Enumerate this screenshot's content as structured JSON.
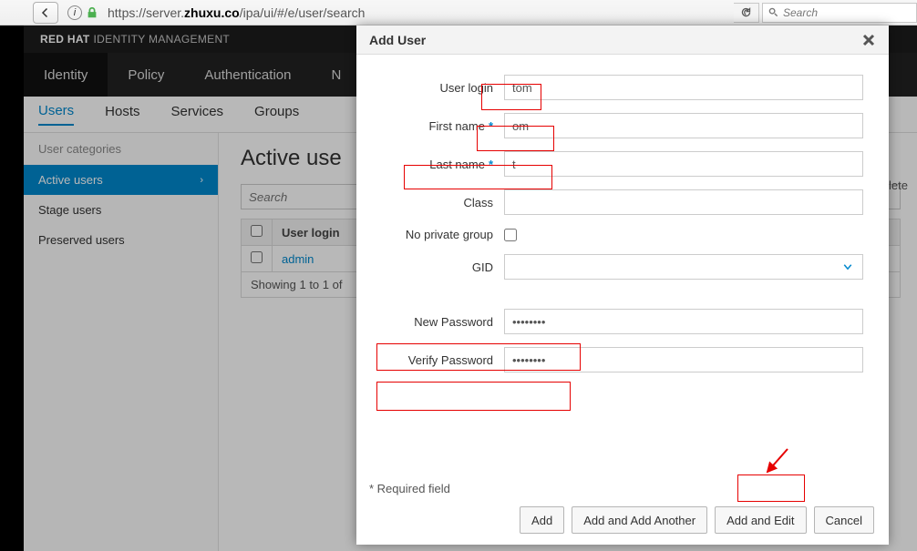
{
  "browser": {
    "url_prefix": "https://server.",
    "url_bold": "zhuxu.co",
    "url_suffix": "/ipa/ui/#/e/user/search",
    "search_placeholder": "Search"
  },
  "header": {
    "brand_strong": "RED HAT",
    "brand_light": "IDENTITY MANAGEMENT"
  },
  "topnav": {
    "identity": "Identity",
    "policy": "Policy",
    "authentication": "Authentication",
    "more": "N"
  },
  "subnav": {
    "users": "Users",
    "hosts": "Hosts",
    "services": "Services",
    "groups": "Groups"
  },
  "sidebar": {
    "heading": "User categories",
    "active": "Active users",
    "stage": "Stage users",
    "preserved": "Preserved users"
  },
  "main": {
    "title": "Active use",
    "search_placeholder": "Search",
    "col_userlogin": "User login",
    "admin_login": "admin",
    "footer": "Showing 1 to 1 of",
    "delete": "Delete"
  },
  "dialog": {
    "title": "Add User",
    "labels": {
      "login": "User login",
      "first": "First name",
      "last": "Last name",
      "class": "Class",
      "npg": "No private group",
      "gid": "GID",
      "newpass": "New Password",
      "verifypass": "Verify Password"
    },
    "values": {
      "login": "tom",
      "first": "om",
      "last": "t",
      "class": "",
      "gid": "",
      "newpass": "••••••••",
      "verifypass": "••••••••"
    },
    "required": "* Required field",
    "buttons": {
      "add": "Add",
      "add_another": "Add and Add Another",
      "add_edit": "Add and Edit",
      "cancel": "Cancel"
    }
  }
}
